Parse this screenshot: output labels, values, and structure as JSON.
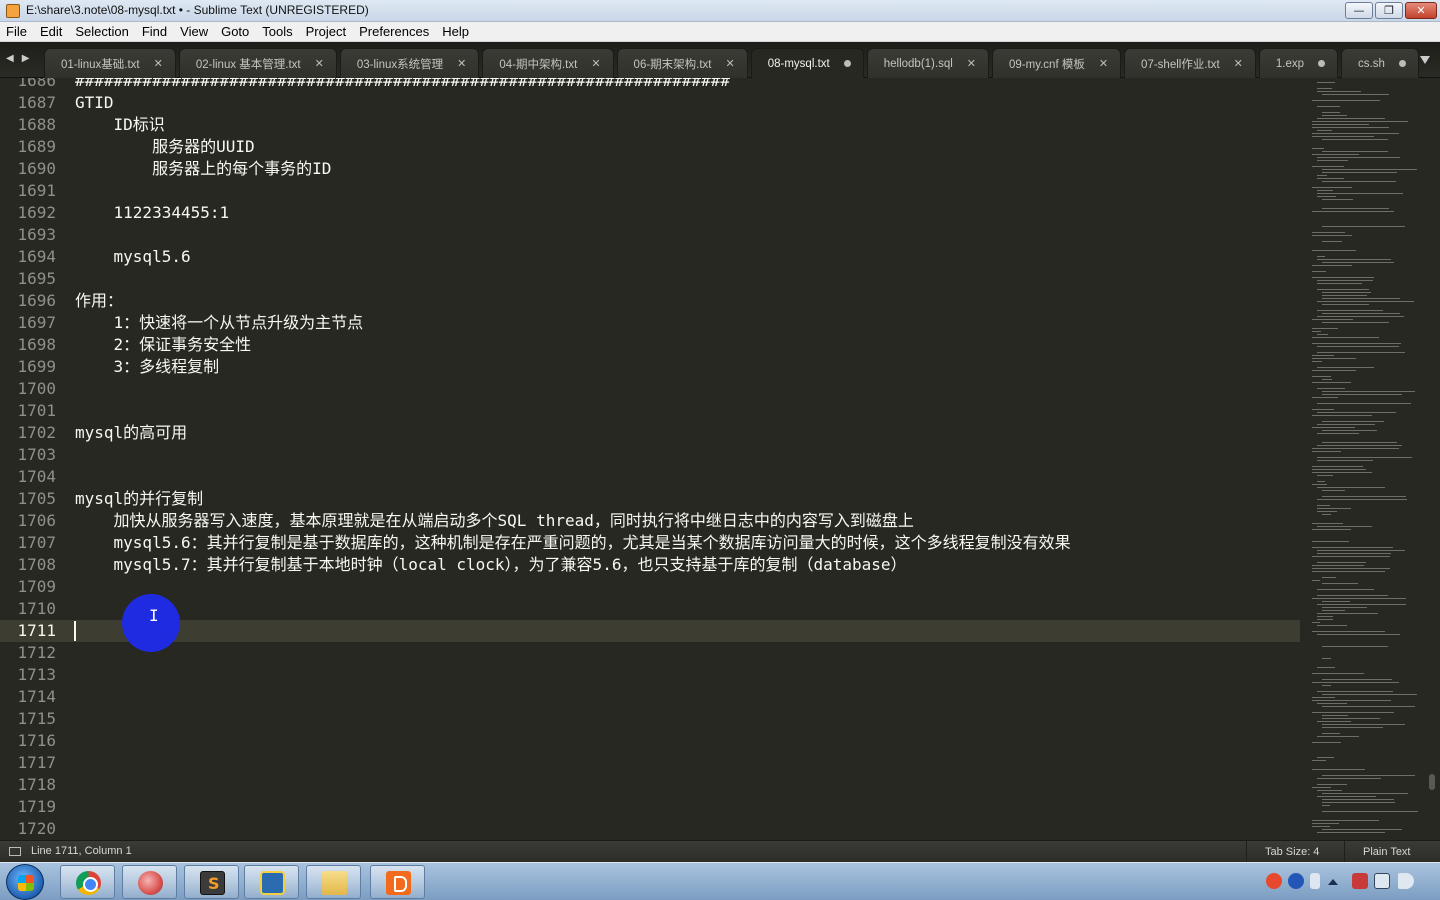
{
  "window": {
    "title": "E:\\share\\3.note\\08-mysql.txt • - Sublime Text (UNREGISTERED)",
    "minimize": "—",
    "maximize": "❐",
    "close": "✕"
  },
  "menu": [
    "File",
    "Edit",
    "Selection",
    "Find",
    "View",
    "Goto",
    "Tools",
    "Project",
    "Preferences",
    "Help"
  ],
  "tabs": [
    {
      "label": "01-linux基础.txt",
      "state": "close"
    },
    {
      "label": "02-linux 基本管理.txt",
      "state": "close"
    },
    {
      "label": "03-linux系统管理",
      "state": "close"
    },
    {
      "label": "04-期中架构.txt",
      "state": "close"
    },
    {
      "label": "06-期末架构.txt",
      "state": "close"
    },
    {
      "label": "08-mysql.txt",
      "state": "dirty",
      "active": true
    },
    {
      "label": "hellodb(1).sql",
      "state": "close"
    },
    {
      "label": "09-my.cnf 模板",
      "state": "close"
    },
    {
      "label": "07-shell作业.txt",
      "state": "close"
    },
    {
      "label": "1.exp",
      "state": "dirty"
    },
    {
      "label": "cs.sh",
      "state": "dirty"
    }
  ],
  "editor": {
    "first_line_number": 1686,
    "current_line": 1711,
    "lines": [
      "####################################################################",
      "GTID",
      "    ID标识",
      "        服务器的UUID",
      "        服务器上的每个事务的ID",
      "",
      "    1122334455:1",
      "",
      "    mysql5.6",
      "",
      "作用：",
      "    1：快速将一个从节点升级为主节点",
      "    2：保证事务安全性",
      "    3：多线程复制",
      "",
      "",
      "mysql的高可用",
      "",
      "",
      "mysql的并行复制",
      "    加快从服务器写入速度，基本原理就是在从端启动多个SQL thread，同时执行将中继日志中的内容写入到磁盘上",
      "    mysql5.6：其并行复制是基于数据库的，这种机制是存在严重问题的，尤其是当某个数据库访问量大的时候，这个多线程复制没有效果",
      "    mysql5.7：其并行复制基于本地时钟（local clock），为了兼容5.6，也只支持基于库的复制（database）",
      "",
      "",
      "",
      "",
      "",
      "",
      "",
      "",
      "",
      "",
      "",
      ""
    ]
  },
  "status": {
    "position": "Line 1711, Column 1",
    "tab_size": "Tab Size: 4",
    "syntax": "Plain Text"
  },
  "colors": {
    "editor_bg": "#272822",
    "text": "#f8f8f2",
    "gutter": "#8f908a",
    "cursor_highlight": "#1f2be0"
  }
}
